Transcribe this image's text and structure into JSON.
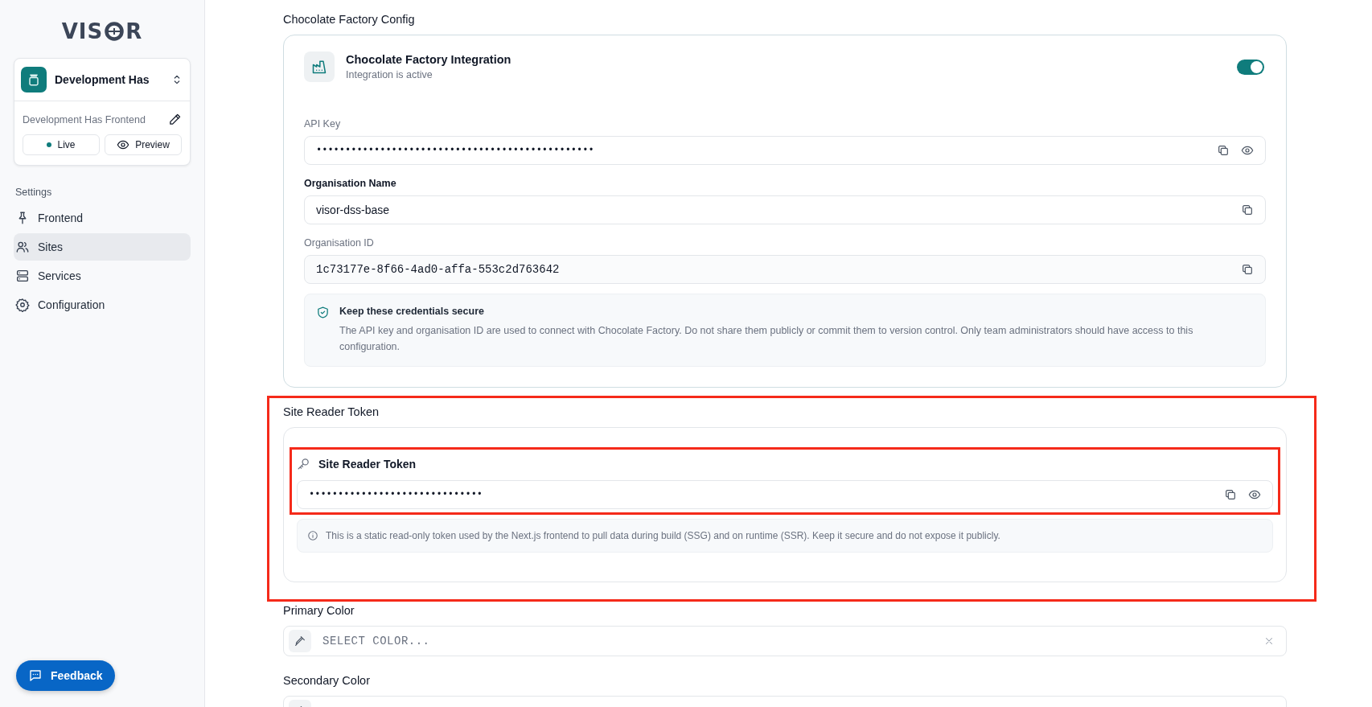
{
  "sidebar": {
    "logo": {
      "before": "VIS",
      "after": "R"
    },
    "project": {
      "name": "Development Has",
      "subtitle": "Development Has Frontend",
      "modes": [
        {
          "label": "Live",
          "kind": "status"
        },
        {
          "label": "Preview",
          "kind": "preview"
        }
      ]
    },
    "nav_heading": "Settings",
    "nav": [
      {
        "label": "Frontend",
        "kind": "pin",
        "selected": false
      },
      {
        "label": "Sites",
        "kind": "users",
        "selected": true
      },
      {
        "label": "Services",
        "kind": "server",
        "selected": false
      },
      {
        "label": "Configuration",
        "kind": "gear",
        "selected": false
      }
    ],
    "feedback": "Feedback"
  },
  "sections": [
    {
      "kind": "integration",
      "title": "Chocolate Factory Config",
      "highlighted": false,
      "integration_title": "Chocolate Factory Integration",
      "status": "Integration is active",
      "enabled": true,
      "fields": [
        {
          "label": "API Key",
          "kind": "secret",
          "value": "••••••••••••••••••••••••••••••••••••••••••••••••"
        },
        {
          "label": "Organisation Name",
          "kind": "text",
          "value": "visor-dss-base"
        },
        {
          "label": "Organisation ID",
          "kind": "id",
          "value": "1c73177e-8f66-4ad0-affa-553c2d763642"
        }
      ],
      "notice": {
        "title": "Keep these credentials secure",
        "text": "The API key and organisation ID are used to connect with Chocolate Factory. Do not share them publicly or commit them to version control. Only team administrators should have access to this configuration."
      }
    },
    {
      "kind": "token",
      "title": "Site Reader Token",
      "highlighted": true,
      "token_title": "Site Reader Token",
      "token_highlighted": true,
      "value": "••••••••••••••••••••••••••••••",
      "note": "This is a static read-only token used by the Next.js frontend to pull data during build (SSG) and on runtime (SSR). Keep it secure and do not expose it publicly."
    },
    {
      "kind": "color",
      "title": "Primary Color",
      "highlighted": false,
      "placeholder": "SELECT COLOR..."
    },
    {
      "kind": "color",
      "title": "Secondary Color",
      "highlighted": false
    }
  ]
}
